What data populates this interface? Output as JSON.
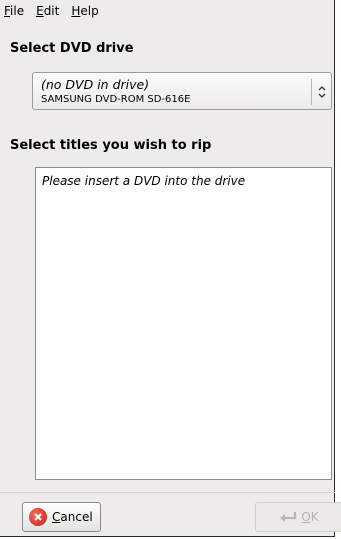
{
  "menubar": {
    "items": [
      {
        "mnemonic": "F",
        "rest": "ile"
      },
      {
        "mnemonic": "E",
        "rest": "dit"
      },
      {
        "mnemonic": "H",
        "rest": "elp"
      }
    ]
  },
  "drive_section": {
    "title": "Select DVD drive",
    "combo": {
      "status": "(no DVD in drive)",
      "device": "SAMSUNG DVD-ROM SD-616E",
      "icon": "combo-arrows-icon"
    }
  },
  "titles_section": {
    "title": "Select titles you wish to rip",
    "empty_message": "Please insert a DVD into the drive"
  },
  "buttons": {
    "cancel": {
      "mnemonic": "C",
      "rest": "ancel",
      "icon": "cancel-icon",
      "enabled": true
    },
    "ok": {
      "mnemonic": "O",
      "rest": "K",
      "icon": "ok-arrow-icon",
      "enabled": false
    }
  },
  "colors": {
    "window_bg": "#edeceb",
    "cancel_icon": "#d9281b",
    "disabled_text": "#b5b3b0"
  }
}
